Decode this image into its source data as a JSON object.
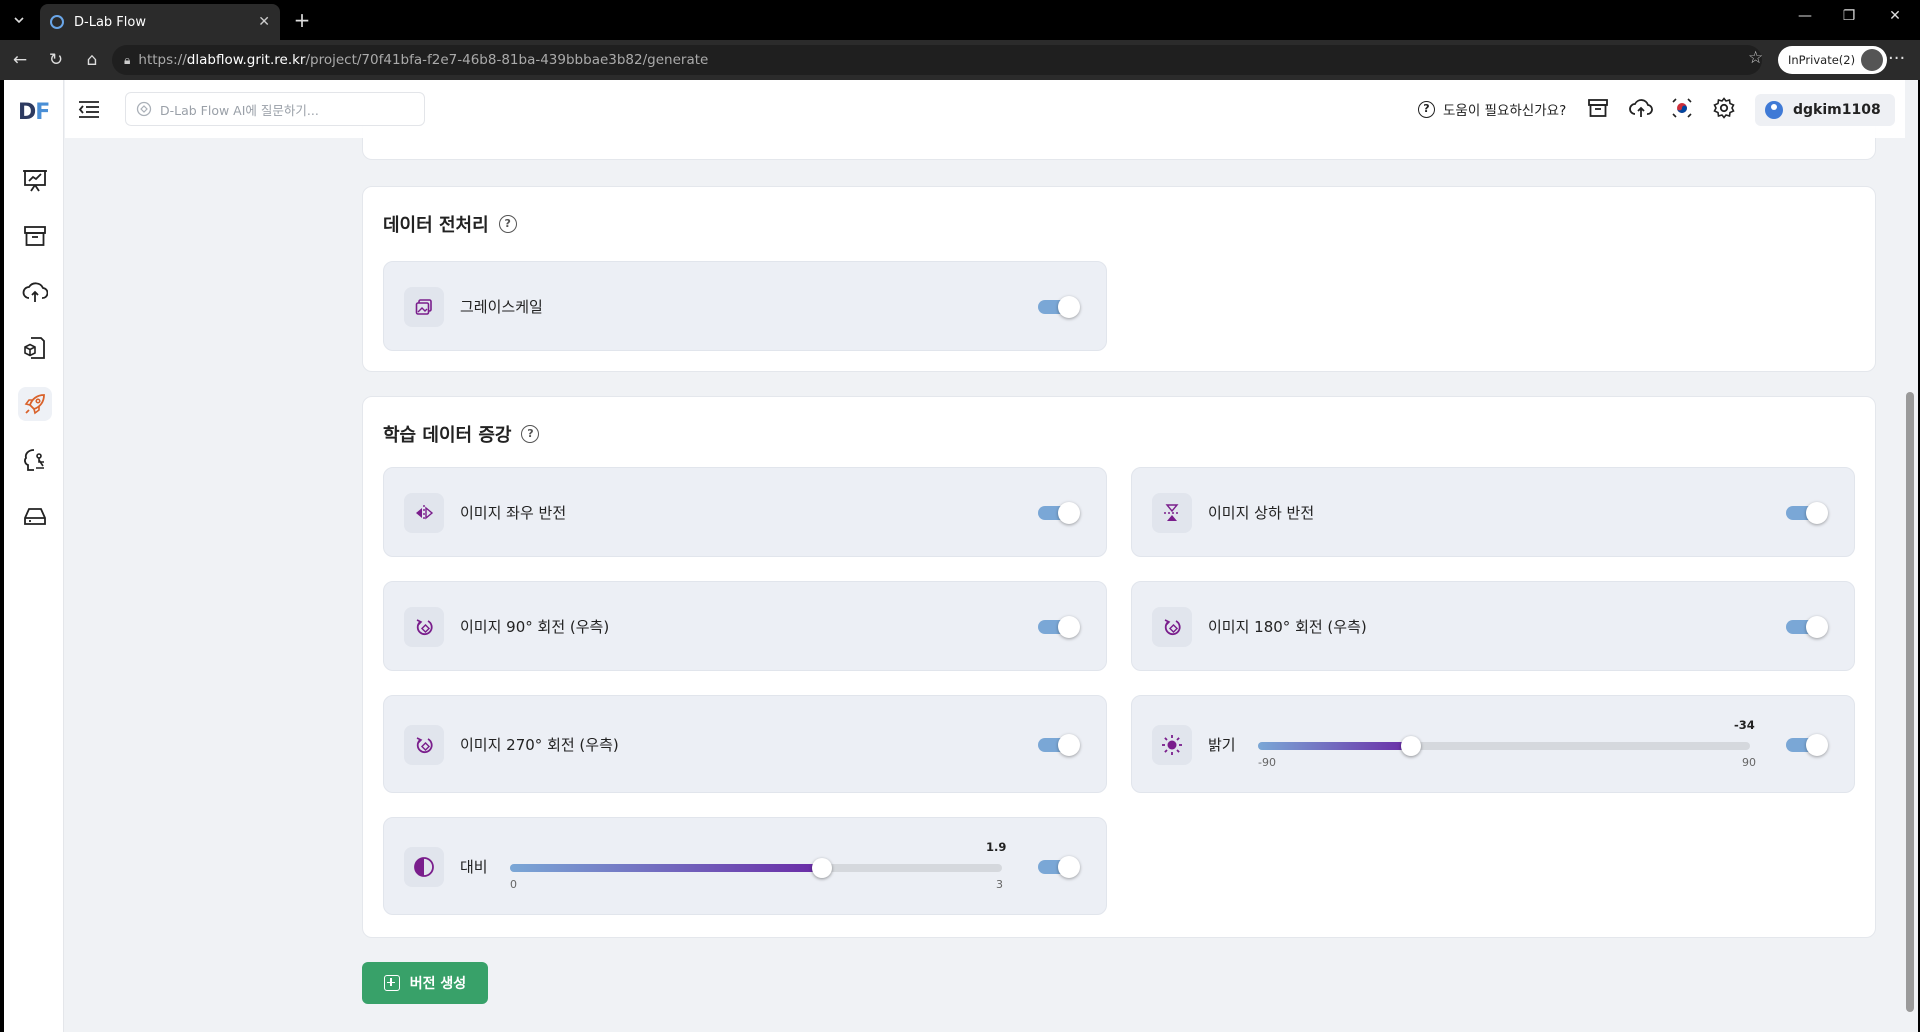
{
  "browser": {
    "tab_title": "D-Lab Flow",
    "url_scheme": "https://",
    "url_host": "dlabflow.grit.re.kr",
    "url_path": "/project/70f41bfa-f2e7-46b8-81ba-439bbbae3b82/generate",
    "inprivate_label": "InPrivate(2)"
  },
  "app": {
    "logo_d": "D",
    "logo_f": "F",
    "search_placeholder": "D-Lab Flow AI에 질문하기...",
    "help_label": "도움이 필요하신가요?",
    "username": "dgkim1108"
  },
  "sidebar": {
    "items": [
      {
        "icon": "presentation-chart-icon",
        "active": false
      },
      {
        "icon": "archive-box-icon",
        "active": false
      },
      {
        "icon": "cloud-upload-icon",
        "active": false
      },
      {
        "icon": "document-cube-icon",
        "active": false
      },
      {
        "icon": "rocket-icon",
        "active": true
      },
      {
        "icon": "brain-icon",
        "active": false
      },
      {
        "icon": "drive-icon",
        "active": false
      }
    ]
  },
  "preprocessing": {
    "title": "데이터 전처리",
    "options": [
      {
        "label": "그레이스케일",
        "icon": "image-grayscale-icon",
        "enabled": true
      }
    ]
  },
  "augmentation": {
    "title": "학습 데이터 증강",
    "options": [
      {
        "label": "이미지 좌우 반전",
        "icon": "flip-horizontal-icon",
        "enabled": true
      },
      {
        "label": "이미지 상하 반전",
        "icon": "flip-vertical-icon",
        "enabled": true
      },
      {
        "label": "이미지 90° 회전 (우측)",
        "icon": "rotate-right-icon",
        "enabled": true
      },
      {
        "label": "이미지 180° 회전 (우측)",
        "icon": "rotate-right-icon",
        "enabled": true
      },
      {
        "label": "이미지 270° 회전 (우측)",
        "icon": "rotate-right-icon",
        "enabled": true
      },
      {
        "label": "밝기",
        "icon": "sun-icon",
        "enabled": true,
        "value": "-34",
        "min": "-90",
        "max": "90",
        "value_num": -34,
        "min_num": -90,
        "max_num": 90
      },
      {
        "label": "대비",
        "icon": "contrast-icon",
        "enabled": true,
        "value": "1.9",
        "min": "0",
        "max": "3",
        "value_num": 1.9,
        "min_num": 0,
        "max_num": 3
      }
    ]
  },
  "actions": {
    "create_version": "버전 생성"
  },
  "colors": {
    "accent_purple": "#7a1e8c",
    "toggle_on": "#7aa7d6",
    "create_button": "#38a169"
  }
}
